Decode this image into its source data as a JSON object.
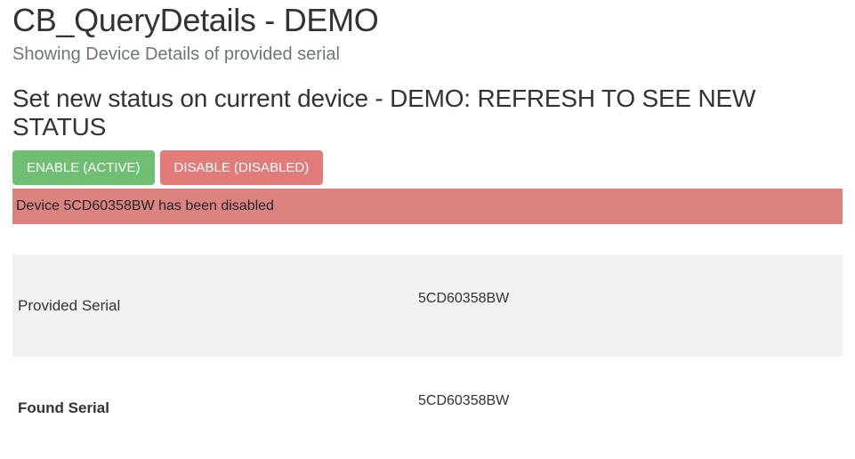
{
  "header": {
    "title": "CB_QueryDetails - DEMO",
    "subtitle": "Showing Device Details of provided serial"
  },
  "status_section": {
    "heading": "Set new status on current device - DEMO: REFRESH TO SEE NEW STATUS",
    "enable_button": "ENABLE (ACTIVE)",
    "disable_button": "DISABLE (DISABLED)",
    "alert_message": "Device 5CD60358BW has been disabled"
  },
  "details": {
    "rows": [
      {
        "label": "Provided Serial",
        "value": "5CD60358BW",
        "bold": false
      },
      {
        "label": "Found Serial",
        "value": "5CD60358BW",
        "bold": true
      }
    ]
  }
}
